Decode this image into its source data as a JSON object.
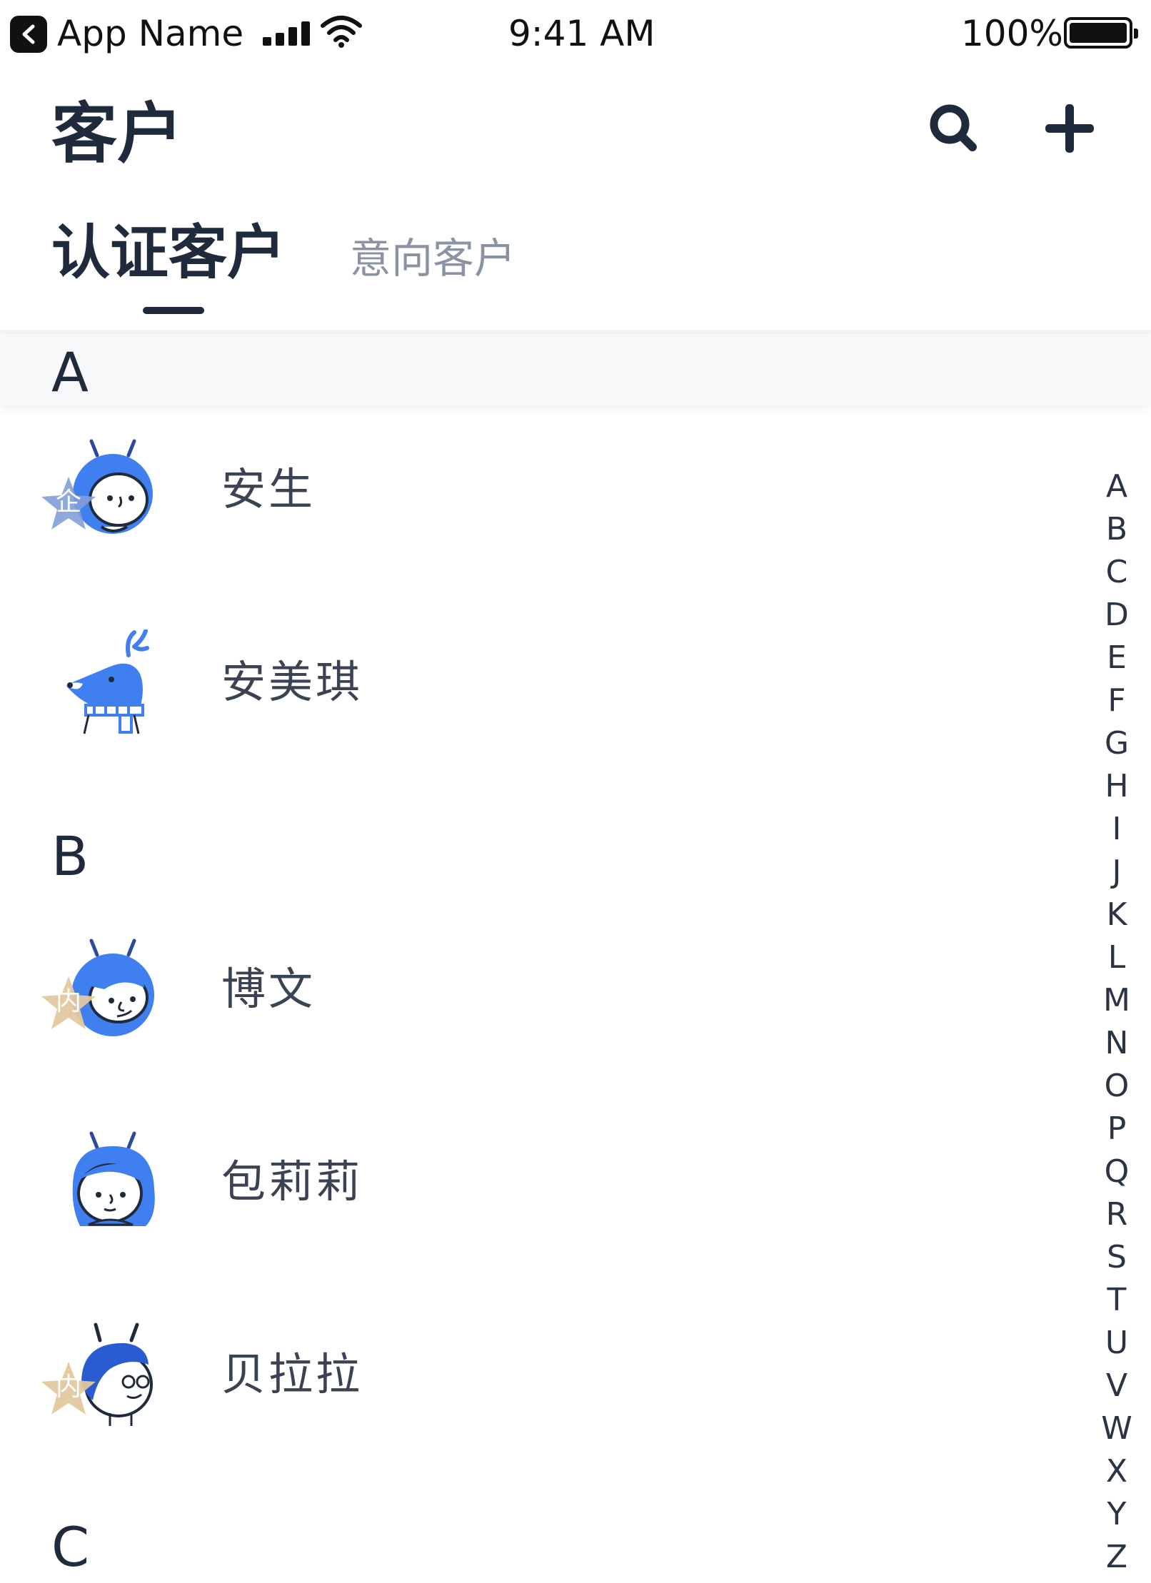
{
  "status_bar": {
    "app_name": "App Name",
    "time": "9:41 AM",
    "battery_percent": "100%",
    "back_icon": "back-arrow-icon",
    "signal_icon": "cellular-signal-icon",
    "wifi_icon": "wifi-icon",
    "battery_icon": "battery-icon",
    "battery_level": 1.0
  },
  "header": {
    "title": "客户",
    "search_icon": "search-icon",
    "add_icon": "plus-icon"
  },
  "tabs": [
    {
      "label": "认证客户",
      "active": true
    },
    {
      "label": "意向客户",
      "active": false
    }
  ],
  "sections": [
    {
      "letter": "A",
      "contacts": [
        {
          "name": "安生",
          "avatar": "ant-avatar-icon",
          "badge": "企",
          "badge_color": "#7f9fd9"
        },
        {
          "name": "安美琪",
          "avatar": "deer-avatar-icon",
          "badge": null
        }
      ]
    },
    {
      "letter": "B",
      "contacts": [
        {
          "name": "博文",
          "avatar": "ant-boy-avatar-icon",
          "badge": "内",
          "badge_color": "#e2c89e"
        },
        {
          "name": "包莉莉",
          "avatar": "ant-girl-avatar-icon",
          "badge": null
        },
        {
          "name": "贝拉拉",
          "avatar": "ant-glasses-avatar-icon",
          "badge": "内",
          "badge_color": "#e2c89e"
        }
      ]
    },
    {
      "letter": "C",
      "contacts": []
    }
  ],
  "alphabet_index": [
    "A",
    "B",
    "C",
    "D",
    "E",
    "F",
    "G",
    "H",
    "I",
    "J",
    "K",
    "L",
    "M",
    "N",
    "O",
    "P",
    "Q",
    "R",
    "S",
    "T",
    "U",
    "V",
    "W",
    "X",
    "Y",
    "Z"
  ],
  "colors": {
    "primary_text": "#1f2a3d",
    "secondary_text": "#8a93a3",
    "avatar_blue": "#3f7ff0",
    "enterprise_badge": "#7f9fd9",
    "internal_badge": "#e2c89e"
  }
}
